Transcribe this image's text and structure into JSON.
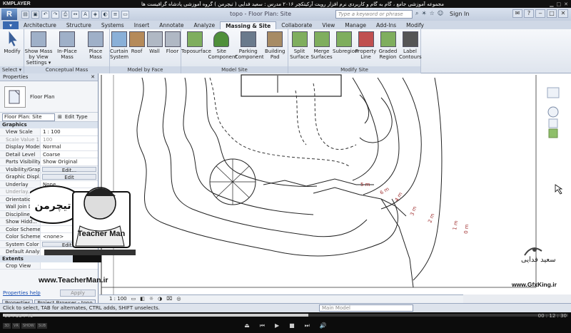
{
  "player": {
    "logo": "KMPLAYER",
    "title": "مجموعه آموزشی جامع ، گام به گام و کاربردی نرم افزار رویت آرکیتکچر ۲۰۱۶   مدرس : سعید فدایی ( تیچرمن ) گروه آموزشی پادشاه گرافیست ها",
    "time_elapsed": "00 : 06 : 46",
    "time_total": "00 : 12 : 30",
    "progress_fraction": 0.54,
    "left_badges": [
      "3D",
      "VR",
      "SHOW",
      "SUB"
    ]
  },
  "titlebar": {
    "app_title": "topo - Floor Plan: Site",
    "search_placeholder": "Type a keyword or phrase",
    "sign_in": "Sign In"
  },
  "tabs": [
    "Architecture",
    "Structure",
    "Systems",
    "Insert",
    "Annotate",
    "Analyze",
    "Massing & Site",
    "Collaborate",
    "View",
    "Manage",
    "Add-Ins",
    "Modify"
  ],
  "active_tab": "Massing & Site",
  "ribbon": {
    "panels": [
      {
        "title": "Select ▾",
        "tools": [
          {
            "label": "Modify",
            "icon": "cursor-icon"
          }
        ]
      },
      {
        "title": "Conceptual Mass",
        "tools": [
          {
            "label": "Show Mass\nby View Settings ▾",
            "icon": "mass-icon"
          },
          {
            "label": "In-Place\nMass",
            "icon": "inplace-mass-icon"
          },
          {
            "label": "Place\nMass",
            "icon": "place-mass-icon"
          }
        ]
      },
      {
        "title": "Model by Face",
        "tools": [
          {
            "label": "Curtain\nSystem",
            "icon": "curtain-system-icon"
          },
          {
            "label": "Roof",
            "icon": "roof-icon"
          },
          {
            "label": "Wall",
            "icon": "wall-icon"
          },
          {
            "label": "Floor",
            "icon": "floor-icon"
          }
        ]
      },
      {
        "title": "Model Site",
        "tools": [
          {
            "label": "Toposurface",
            "icon": "toposurface-icon"
          },
          {
            "label": "Site\nComponent",
            "icon": "tree-icon"
          },
          {
            "label": "Parking\nComponent",
            "icon": "parking-icon"
          },
          {
            "label": "Building\nPad",
            "icon": "building-pad-icon"
          }
        ]
      },
      {
        "title": "Modify Site",
        "tools": [
          {
            "label": "Split\nSurface",
            "icon": "split-surface-icon"
          },
          {
            "label": "Merge\nSurfaces",
            "icon": "merge-surfaces-icon"
          },
          {
            "label": "Subregion",
            "icon": "subregion-icon"
          },
          {
            "label": "Property\nLine",
            "icon": "property-line-icon"
          },
          {
            "label": "Graded\nRegion",
            "icon": "graded-region-icon"
          },
          {
            "label": "Label\nContours",
            "icon": "label-contours-icon"
          }
        ]
      }
    ]
  },
  "properties": {
    "header": "Properties",
    "type_name": "Floor Plan",
    "instance_selector": "Floor Plan: Site",
    "edit_type": "Edit Type",
    "group_graphics": "Graphics",
    "rows": [
      {
        "k": "View Scale",
        "v": "1 : 100"
      },
      {
        "k": "Scale Value  1:",
        "v": "100",
        "dim": true
      },
      {
        "k": "Display Model",
        "v": "Normal"
      },
      {
        "k": "Detail Level",
        "v": "Coarse"
      },
      {
        "k": "Parts Visibility",
        "v": "Show Original"
      },
      {
        "k": "Visibility/Graph...",
        "v": "Edit...",
        "btn": true
      },
      {
        "k": "Graphic Displ...",
        "v": "Edit",
        "btn": true
      },
      {
        "k": "Underlay",
        "v": "None"
      },
      {
        "k": "Underlay...",
        "v": "",
        "dim": true
      },
      {
        "k": "Orientation",
        "v": ""
      },
      {
        "k": "Wall Join Di...",
        "v": ""
      },
      {
        "k": "Discipline",
        "v": ""
      },
      {
        "k": "Show Hidd...",
        "v": ""
      },
      {
        "k": "Color Scheme...",
        "v": ""
      },
      {
        "k": "Color Scheme",
        "v": "<none>"
      },
      {
        "k": "System Color S...",
        "v": "Edit...",
        "btn": true
      },
      {
        "k": "Default Analysis...",
        "v": ""
      }
    ],
    "group_extents": "Extents",
    "crop_view": "Crop View",
    "help_link": "Properties help",
    "apply": "Apply",
    "tab_properties": "Properties",
    "tab_browser": "Project Browser - topo"
  },
  "canvas": {
    "contour_labels": [
      "5 m",
      "4 m",
      "3 m",
      "2 m",
      "1 m",
      "0 m",
      "6 m"
    ]
  },
  "view_bar": {
    "scale": "1 : 100"
  },
  "status": {
    "hint": "Click to select, TAB for alternates, CTRL adds, SHIFT unselects.",
    "model": "Main Model"
  },
  "watermark": {
    "site": "www.TeacherMan.ir",
    "brand": "Teacher Man",
    "gfx_site": "www.GfxKing.ir",
    "gfx_sign": "سعید فدایی"
  }
}
